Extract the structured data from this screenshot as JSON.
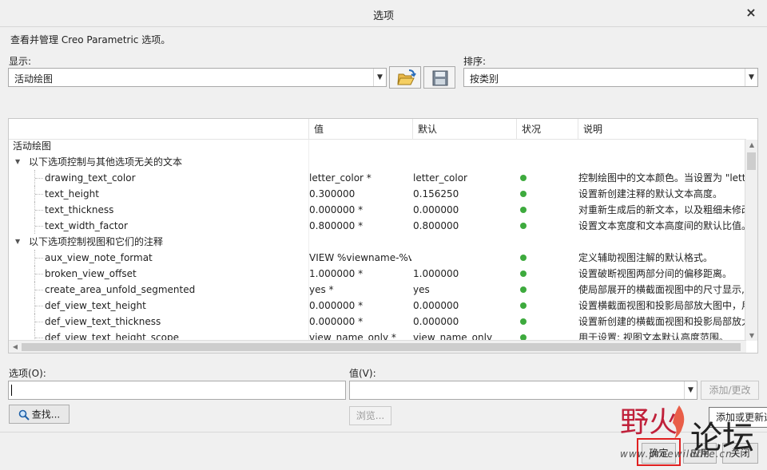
{
  "dialog": {
    "title": "选项",
    "close_glyph": "×"
  },
  "description": "查看并管理 Creo Parametric 选项。",
  "display": {
    "label": "显示:",
    "value": "活动绘图"
  },
  "sort": {
    "label": "排序:",
    "value": "按类别"
  },
  "icons": {
    "open": "folder-open-icon",
    "save": "floppy-save-icon"
  },
  "table": {
    "columns": [
      "值",
      "默认",
      "状况",
      "说明"
    ],
    "root": "活动绘图",
    "groups": [
      {
        "title": "以下选项控制与其他选项无关的文本",
        "rows": [
          {
            "name": "drawing_text_color",
            "value": "letter_color *",
            "default": "letter_color",
            "desc": "控制绘图中的文本颜色。当设置为 \"lett"
          },
          {
            "name": "text_height",
            "value": "0.300000",
            "default": "0.156250",
            "desc": "设置新创建注释的默认文本高度。"
          },
          {
            "name": "text_thickness",
            "value": "0.000000 *",
            "default": "0.000000",
            "desc": "对重新生成后的新文本，以及粗细未修改"
          },
          {
            "name": "text_width_factor",
            "value": "0.800000 *",
            "default": "0.800000",
            "desc": "设置文本宽度和文本高度间的默认比值。"
          }
        ]
      },
      {
        "title": "以下选项控制视图和它们的注释",
        "rows": [
          {
            "name": "aux_view_note_format",
            "value": "VIEW %viewname-%vi",
            "default": "",
            "desc": "定义辅助视图注解的默认格式。"
          },
          {
            "name": "broken_view_offset",
            "value": "1.000000 *",
            "default": "1.000000",
            "desc": "设置破断视图两部分间的偏移距离。"
          },
          {
            "name": "create_area_unfold_segmented",
            "value": "yes *",
            "default": "yes",
            "desc": "使局部展开的横截面视图中的尺寸显示,"
          },
          {
            "name": "def_view_text_height",
            "value": "0.000000 *",
            "default": "0.000000",
            "desc": "设置横截面视图和投影局部放大图中，用"
          },
          {
            "name": "def_view_text_thickness",
            "value": "0.000000 *",
            "default": "0.000000",
            "desc": "设置新创建的横截面视图和投影局部放大"
          },
          {
            "name": "def_view_text_height_scope",
            "value": "view_name_only *",
            "default": "view_name_only",
            "desc": "用于设置: 视图文本默认高度范围。"
          }
        ]
      }
    ]
  },
  "option": {
    "label": "选项(O):",
    "value": ""
  },
  "value": {
    "label": "值(V):",
    "value": ""
  },
  "buttons": {
    "add_change": "添加/更改",
    "find": "查找...",
    "browse": "浏览...",
    "ok": "确定",
    "apply": "应用",
    "close": "关闭"
  },
  "tooltip": "添加或更新选",
  "watermark": {
    "brand": "野火",
    "forum": "论坛",
    "url": "www.proewildfire.cn"
  },
  "colors": {
    "status_ok": "#3daa3d",
    "highlight": "#e02020"
  }
}
